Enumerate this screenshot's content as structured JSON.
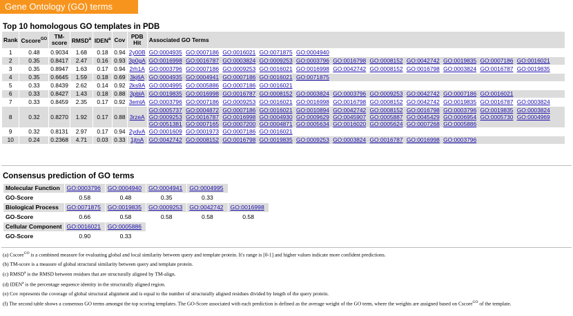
{
  "banner": "Gene Ontology (GO) terms",
  "templates": {
    "title": "Top 10 homologous GO templates in PDB",
    "headers": {
      "rank": "Rank",
      "cscore": "Cscore",
      "cscore_sup": "GO",
      "tm1": "TM-",
      "tm2": "score",
      "rmsd": "RMSD",
      "rmsd_sup": "a",
      "iden": "IDEN",
      "iden_sup": "a",
      "cov": "Cov",
      "pdb1": "PDB",
      "pdb2": "Hit",
      "terms": "Associated GO Terms"
    },
    "rows": [
      {
        "rank": "1",
        "cscore": "0.48",
        "tm": "0.9034",
        "rmsd": "1.68",
        "iden": "0.18",
        "cov": "0.94",
        "pdb": "2y00B",
        "terms": [
          "GO:0004935",
          "GO:0007186",
          "GO:0016021",
          "GO:0071875",
          "GO:0004940"
        ]
      },
      {
        "rank": "2",
        "cscore": "0.35",
        "tm": "0.8417",
        "rmsd": "2.47",
        "iden": "0.16",
        "cov": "0.93",
        "pdb": "3p0gA",
        "terms": [
          "GO:0016998",
          "GO:0016787",
          "GO:0003824",
          "GO:0009253",
          "GO:0003796",
          "GO:0016798",
          "GO:0008152",
          "GO:0042742",
          "GO:0019835",
          "GO:0007186",
          "GO:0016021"
        ]
      },
      {
        "rank": "3",
        "cscore": "0.35",
        "tm": "0.8947",
        "rmsd": "1.63",
        "iden": "0.17",
        "cov": "0.94",
        "pdb": "2rh1A",
        "terms": [
          "GO:0003796",
          "GO:0007186",
          "GO:0009253",
          "GO:0016021",
          "GO:0016998",
          "GO:0042742",
          "GO:0008152",
          "GO:0016798",
          "GO:0003824",
          "GO:0016787",
          "GO:0019835"
        ]
      },
      {
        "rank": "4",
        "cscore": "0.35",
        "tm": "0.6645",
        "rmsd": "1.59",
        "iden": "0.18",
        "cov": "0.69",
        "pdb": "3kj6A",
        "terms": [
          "GO:0004935",
          "GO:0004941",
          "GO:0007186",
          "GO:0016021",
          "GO:0071875"
        ]
      },
      {
        "rank": "5",
        "cscore": "0.33",
        "tm": "0.8439",
        "rmsd": "2.62",
        "iden": "0.14",
        "cov": "0.92",
        "pdb": "2ks9A",
        "terms": [
          "GO:0004995",
          "GO:0005886",
          "GO:0007186",
          "GO:0016021"
        ]
      },
      {
        "rank": "6",
        "cscore": "0.33",
        "tm": "0.8427",
        "rmsd": "1.43",
        "iden": "0.18",
        "cov": "0.88",
        "pdb": "3pblA",
        "terms": [
          "GO:0019835",
          "GO:0016998",
          "GO:0016787",
          "GO:0008152",
          "GO:0003824",
          "GO:0003796",
          "GO:0009253",
          "GO:0042742",
          "GO:0007186",
          "GO:0016021"
        ]
      },
      {
        "rank": "7",
        "cscore": "0.33",
        "tm": "0.8459",
        "rmsd": "2.35",
        "iden": "0.17",
        "cov": "0.92",
        "pdb": "3emlA",
        "terms": [
          "GO:0003796",
          "GO:0007186",
          "GO:0009253",
          "GO:0016021",
          "GO:0016998",
          "GO:0016798",
          "GO:0008152",
          "GO:0042742",
          "GO:0019835",
          "GO:0016787",
          "GO:0003824"
        ]
      },
      {
        "rank": "8",
        "cscore": "0.32",
        "tm": "0.8270",
        "rmsd": "1.92",
        "iden": "0.17",
        "cov": "0.88",
        "pdb": "3rzeA",
        "terms": [
          "GO:0005737",
          "GO:0004872",
          "GO:0007186",
          "GO:0016021",
          "GO:0010894",
          "GO:0042742",
          "GO:0008152",
          "GO:0016798",
          "GO:0003796",
          "GO:0019835",
          "GO:0003824",
          "GO:0009253",
          "GO:0016787",
          "GO:0016998",
          "GO:0004930",
          "GO:0009629",
          "GO:0045907",
          "GO:0005887",
          "GO:0045429",
          "GO:0006954",
          "GO:0005730",
          "GO:0004969",
          "GO:0051381",
          "GO:0007165",
          "GO:0007200",
          "GO:0004871",
          "GO:0005634",
          "GO:0016020",
          "GO:0005624",
          "GO:0007268",
          "GO:0005886"
        ]
      },
      {
        "rank": "9",
        "cscore": "0.32",
        "tm": "0.8131",
        "rmsd": "2.97",
        "iden": "0.17",
        "cov": "0.94",
        "pdb": "2ydvA",
        "terms": [
          "GO:0001609",
          "GO:0001973",
          "GO:0007186",
          "GO:0016021"
        ]
      },
      {
        "rank": "10",
        "cscore": "0.24",
        "tm": "0.2368",
        "rmsd": "4.71",
        "iden": "0.03",
        "cov": "0.33",
        "pdb": "1jtnA",
        "terms": [
          "GO:0042742",
          "GO:0008152",
          "GO:0016798",
          "GO:0019835",
          "GO:0009253",
          "GO:0003824",
          "GO:0016787",
          "GO:0016998",
          "GO:0003796"
        ]
      }
    ]
  },
  "consensus": {
    "title": "Consensus prediction of GO terms",
    "score_label": "GO-Score",
    "groups": [
      {
        "label": "Molecular Function",
        "terms": [
          "GO:0003796",
          "GO:0004940",
          "GO:0004941",
          "GO:0004995"
        ],
        "scores": [
          "0.58",
          "0.48",
          "0.35",
          "0.33"
        ]
      },
      {
        "label": "Biological Process",
        "terms": [
          "GO:0071875",
          "GO:0019835",
          "GO:0009253",
          "GO:0042742",
          "GO:0016998"
        ],
        "scores": [
          "0.66",
          "0.58",
          "0.58",
          "0.58",
          "0.58"
        ]
      },
      {
        "label": "Cellular Component",
        "terms": [
          "GO:0016021",
          "GO:0005886"
        ],
        "scores": [
          "0.90",
          "0.33"
        ]
      }
    ]
  },
  "notes": [
    {
      "mark": "(a)",
      "pre": "Cscore",
      "sup": "GO",
      "post": " is a combined measure for evaluating global and local similarity between query and template protein. It's range is [0-1] and higher values indicate more confident predictions."
    },
    {
      "mark": "(b)",
      "pre": "TM-score is a measure of global structural similarity between query and template protein.",
      "sup": "",
      "post": ""
    },
    {
      "mark": "(c)",
      "pre": "RMSD",
      "sup": "a",
      "post": " is the RMSD between residues that are structurally aligned by TM-align."
    },
    {
      "mark": "(d)",
      "pre": "IDEN",
      "sup": "a",
      "post": " is the percentage sequence identity in the structurally aligned region."
    },
    {
      "mark": "(e)",
      "pre": "Cov represents the coverage of global structural alignment and is equal to the number of structurally aligned residues divided by length of the query protein.",
      "sup": "",
      "post": ""
    },
    {
      "mark": "(f)",
      "pre": "The second table shows a consensus GO terms amongst the top scoring templates. The GO-Score associated with each prediction is defined as the average weight of the GO term, where the weights are assigned based on Cscore",
      "sup": "GO",
      "post": " of the template."
    }
  ]
}
